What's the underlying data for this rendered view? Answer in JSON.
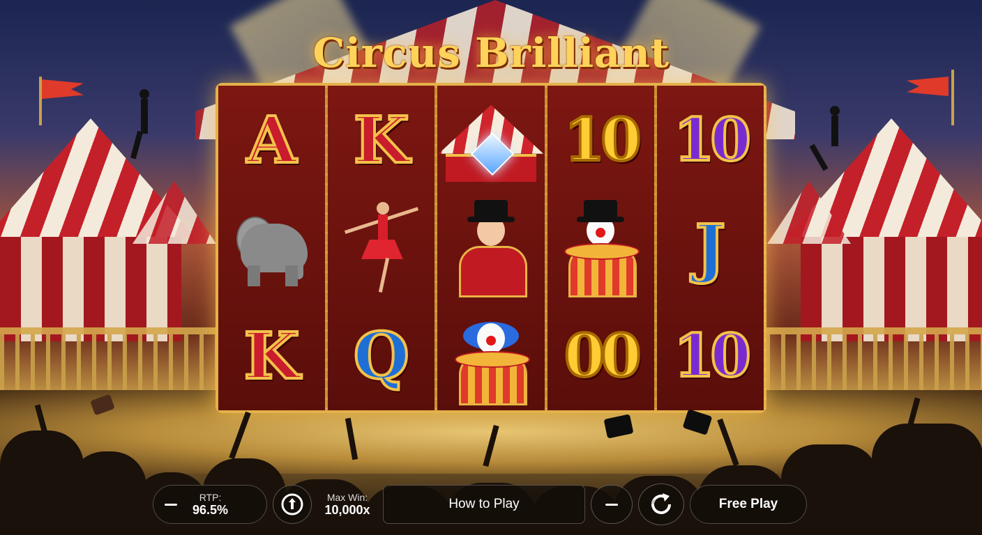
{
  "game": {
    "title": "Circus Brilliant"
  },
  "reels": [
    [
      "A",
      "elephant",
      "K"
    ],
    [
      "K",
      "acrobat-dancer",
      "Q"
    ],
    [
      "diamond-tent",
      "ringmaster",
      "clown"
    ],
    [
      "10",
      "clown",
      "00"
    ],
    [
      "10",
      "J",
      "10"
    ]
  ],
  "symbols": {
    "r1c1": "A",
    "r1c3": "K",
    "r2c1": "K",
    "r2c3": "Q",
    "r4c1": "10",
    "r4c3": "00",
    "r5c1": "10",
    "r5c2": "J",
    "r5c3": "10"
  },
  "controls": {
    "rtp_label": "RTP:",
    "rtp_value": "96.5%",
    "maxwin_label": "Max Win:",
    "maxwin_value": "10,000x",
    "how_to_play": "How to Play",
    "free_play": "Free Play"
  },
  "icons": [
    "minus-icon",
    "info-icon",
    "minus-icon",
    "refresh-icon"
  ],
  "colors": {
    "accent": "#ffd35a",
    "reel_bg": "#6e1410",
    "frame": "#e4b24a"
  }
}
